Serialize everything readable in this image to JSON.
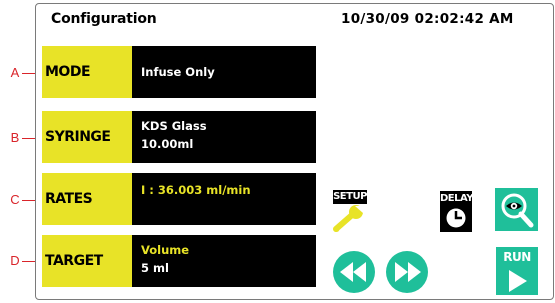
{
  "callouts": [
    "A",
    "B",
    "C",
    "D"
  ],
  "header": {
    "title": "Configuration",
    "datetime": "10/30/09 02:02:42 AM"
  },
  "params": {
    "mode": {
      "label": "MODE",
      "value": "Infuse Only"
    },
    "syringe": {
      "label": "SYRINGE",
      "line1": "KDS Glass",
      "line2": "10.00ml"
    },
    "rates": {
      "label": "RATES",
      "value": "I : 36.003 ml/min"
    },
    "target": {
      "label": "TARGET",
      "line1": "Volume",
      "line2": "5 ml"
    }
  },
  "buttons": {
    "setup": "SETUP",
    "delay": "DELAY",
    "run": "RUN"
  },
  "icons": [
    "wrench-icon",
    "clock-icon",
    "magnifier-eye-icon",
    "rewind-icon",
    "fast-forward-icon",
    "play-icon"
  ],
  "colors": {
    "label_yellow": "#e8e327",
    "panel_black": "#000000",
    "teal_button": "#1fbf9a",
    "callout_red": "#d9242a"
  }
}
